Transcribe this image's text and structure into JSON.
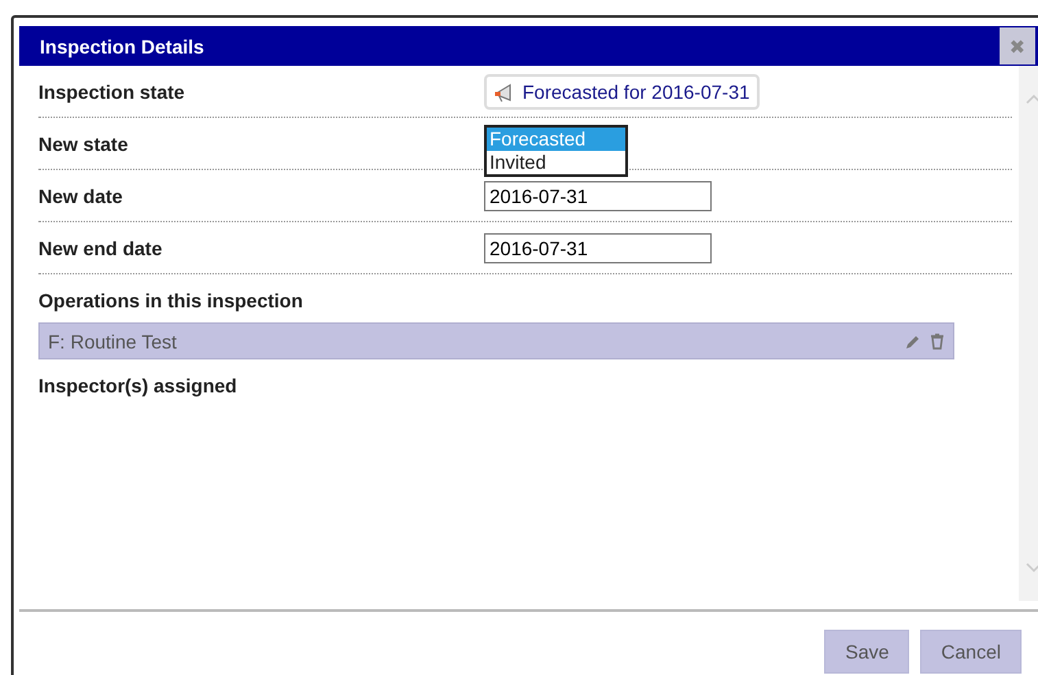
{
  "dialog": {
    "title": "Inspection Details",
    "close_label": "✖"
  },
  "fields": [
    {
      "kind": "status",
      "label": "Inspection state",
      "value": "Forecasted for 2016-07-31"
    },
    {
      "kind": "select",
      "label": "New state",
      "expanded": true,
      "options": [
        {
          "label": "Forecasted",
          "selected": true
        },
        {
          "label": "Invited",
          "selected": false
        }
      ]
    },
    {
      "kind": "date",
      "label": "New date",
      "value": "2016-07-31"
    },
    {
      "kind": "date",
      "label": "New end date",
      "value": "2016-07-31"
    }
  ],
  "operations": {
    "heading": "Operations in this inspection",
    "items": [
      {
        "label": "F: Routine Test"
      }
    ]
  },
  "inspectors": {
    "heading": "Inspector(s) assigned"
  },
  "buttons": [
    {
      "label": "Save"
    },
    {
      "label": "Cancel"
    }
  ]
}
